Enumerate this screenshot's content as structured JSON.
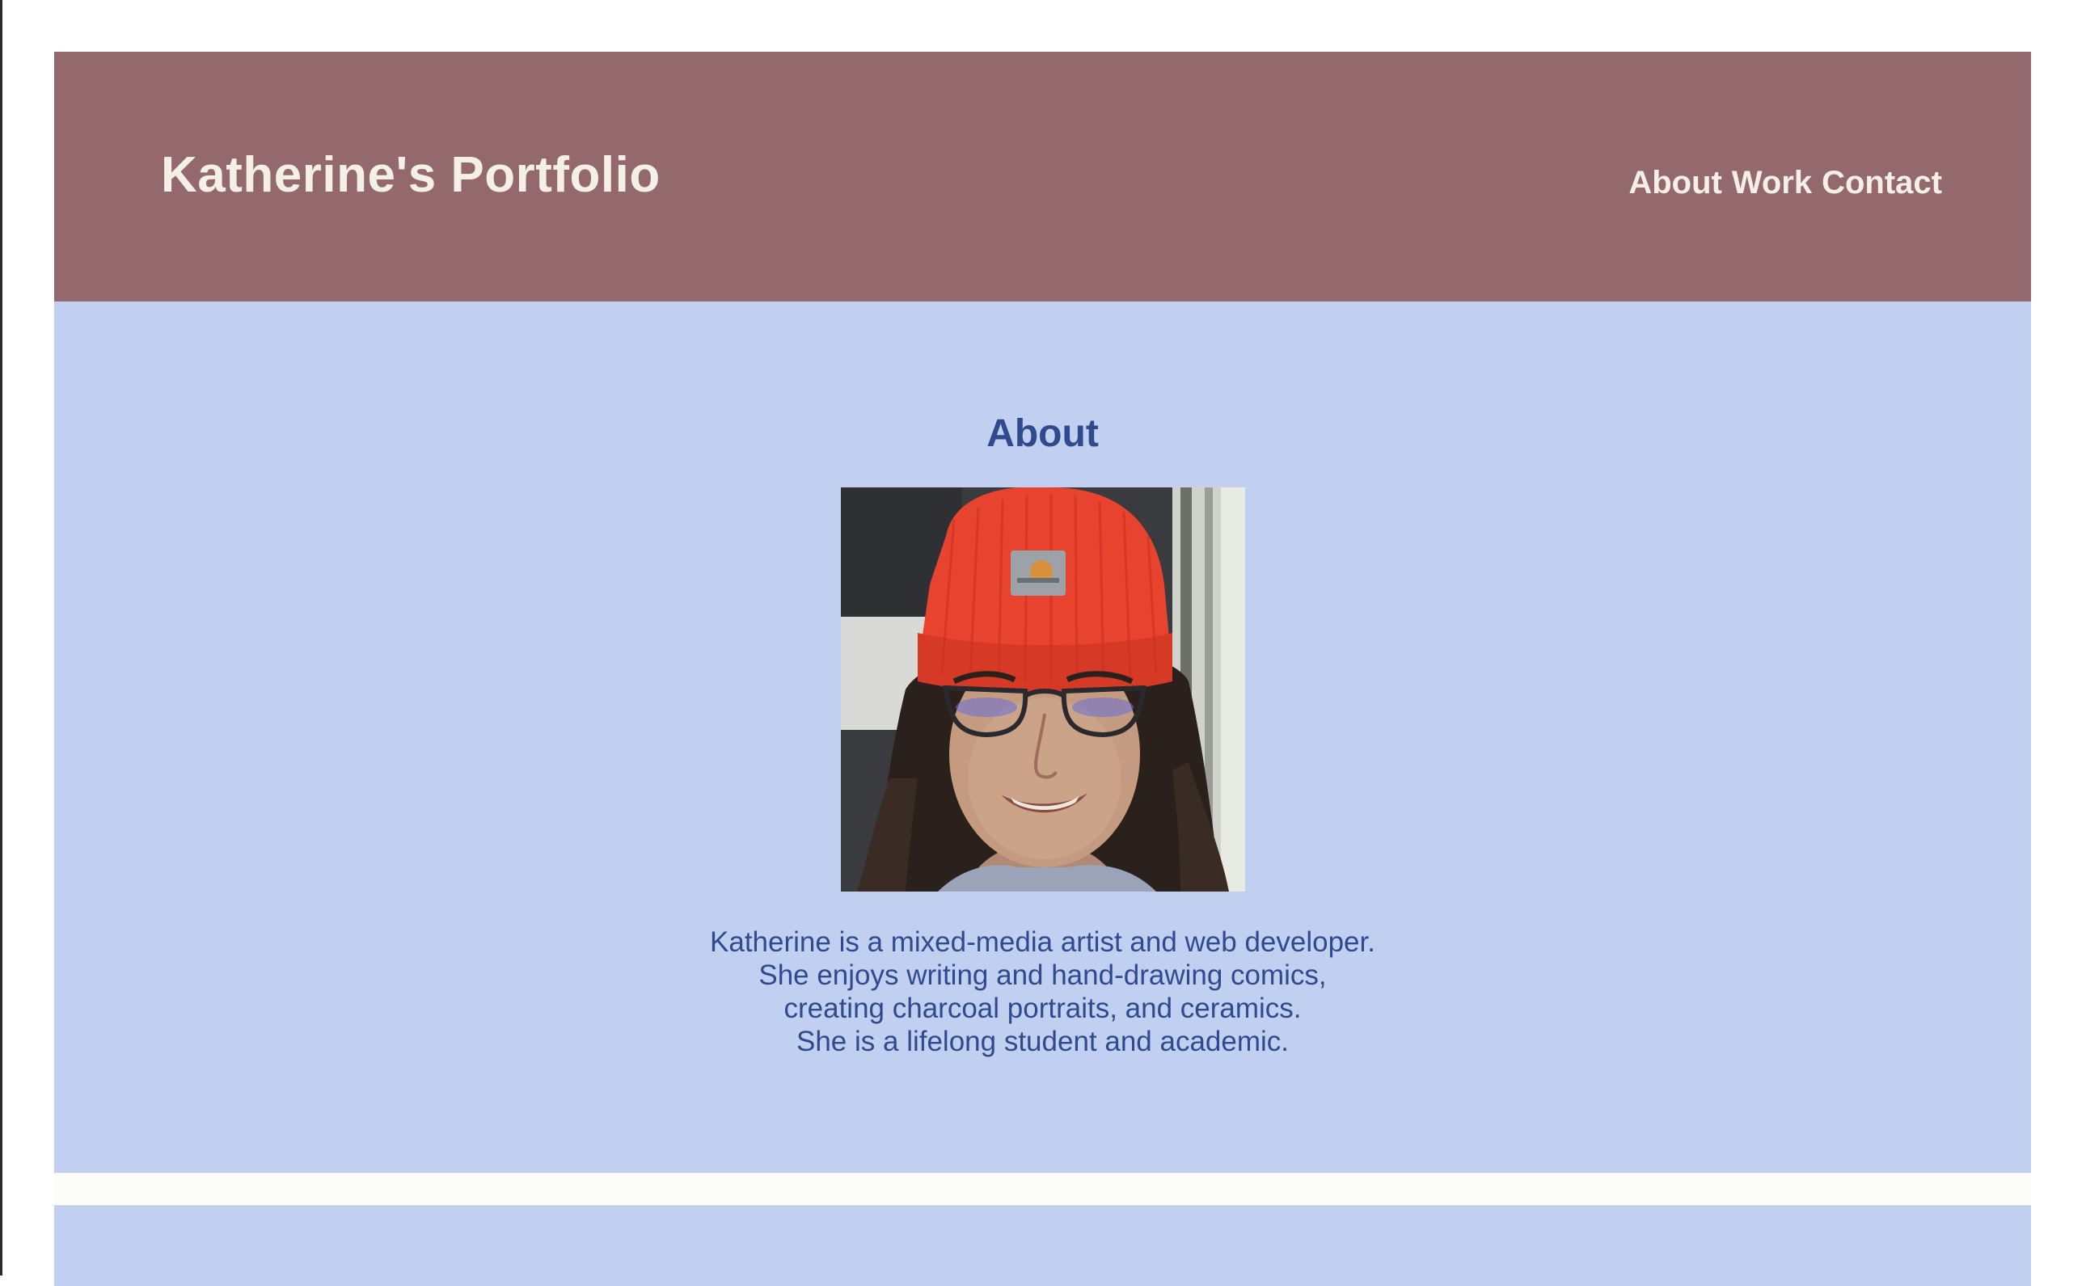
{
  "header": {
    "title": "Katherine's Portfolio",
    "nav": [
      {
        "label": "About"
      },
      {
        "label": "Work"
      },
      {
        "label": "Contact"
      }
    ]
  },
  "about": {
    "heading": "About",
    "portrait_alt": "Portrait of Katherine wearing a red beanie and glasses",
    "bio_lines": [
      "Katherine is a mixed-media artist and web developer.",
      "She enjoys writing and hand-drawing comics,",
      "creating charcoal portraits, and ceramics.",
      "She is a lifelong student and academic."
    ]
  },
  "colors": {
    "header_bg": "#94696d",
    "header_text": "#f5f0e6",
    "section_bg": "#c1d0f0",
    "section_text": "#2f4a8f"
  }
}
